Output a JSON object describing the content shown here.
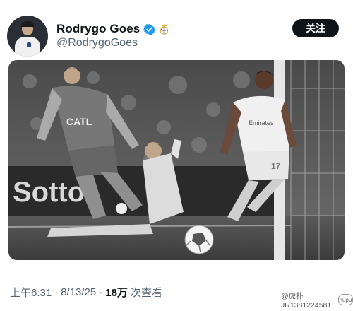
{
  "author": {
    "display_name": "Rodrygo Goes",
    "handle": "@RodrygoGoes",
    "follow_label": "关注"
  },
  "media": {
    "scene_text": {
      "sponsor": "CATL",
      "home_kit_sponsor": "Emirates",
      "away_number": "17",
      "board_text": "Sotto"
    }
  },
  "meta": {
    "time": "上午6:31",
    "separator": "·",
    "date": "8/13/25",
    "views_count": "18万",
    "views_label": "次查看"
  },
  "watermark": {
    "text": "@虎扑JR1381224581",
    "icon_text": "hupu"
  },
  "colors": {
    "accent_verified": "#1d9bf0",
    "follow_bg": "#0f1419"
  }
}
